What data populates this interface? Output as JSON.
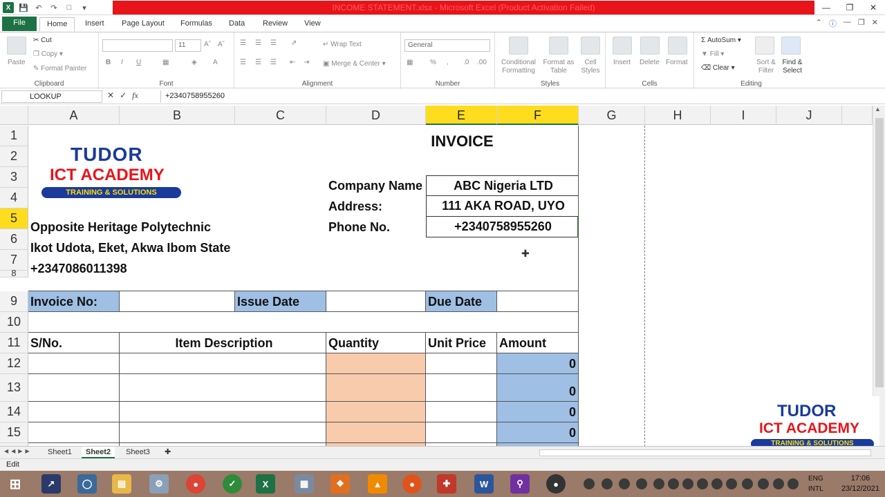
{
  "window": {
    "title": "INCOME STATEMENT.xlsx - Microsoft Excel (Product Activation Failed)",
    "help_icon": "help-icon"
  },
  "ribbon_tabs": [
    "File",
    "Home",
    "Insert",
    "Page Layout",
    "Formulas",
    "Data",
    "Review",
    "View"
  ],
  "ribbon": {
    "clipboard": {
      "paste": "Paste",
      "cut": "Cut",
      "copy": "Copy",
      "format_painter": "Format Painter",
      "label": "Clipboard"
    },
    "font": {
      "size": "11",
      "bold": "B",
      "italic": "I",
      "underline": "U",
      "label": "Font"
    },
    "alignment": {
      "wrap_text": "Wrap Text",
      "merge_center": "Merge & Center",
      "label": "Alignment"
    },
    "number": {
      "format": "General",
      "percent": "%",
      "comma": ",",
      "label": "Number"
    },
    "styles": {
      "conditional": "Conditional Formatting",
      "format_table": "Format as Table",
      "cell_styles": "Cell Styles",
      "label": "Styles"
    },
    "cells": {
      "insert": "Insert",
      "delete": "Delete",
      "format": "Format",
      "label": "Cells"
    },
    "editing": {
      "autosum": "AutoSum",
      "fill": "Fill",
      "clear": "Clear",
      "sort_filter": "Sort & Filter",
      "find_select": "Find & Select",
      "label": "Editing"
    }
  },
  "formula_bar": {
    "name_box": "LOOKUP",
    "cancel": "✕",
    "enter": "✓",
    "fx": "fx",
    "value": "+2340758955260"
  },
  "columns": [
    "A",
    "B",
    "C",
    "D",
    "E",
    "F",
    "G",
    "H",
    "I",
    "J"
  ],
  "rows": [
    "1",
    "2",
    "3",
    "4",
    "5",
    "6",
    "7",
    "8",
    "9",
    "10",
    "11",
    "12",
    "13",
    "14",
    "15"
  ],
  "invoice": {
    "title": "INVOICE",
    "logo": {
      "line1": "TUDOR",
      "line2": "ICT ACADEMY",
      "line3": "TRAINING & SOLUTIONS"
    },
    "company_label": "Company Name",
    "company_value": "ABC Nigeria LTD",
    "address_label": "Address:",
    "address_value": "111 AKA ROAD, UYO",
    "phone_label": "Phone No.",
    "phone_value": "+2340758955260",
    "sender_line1": "Opposite Heritage Polytechnic",
    "sender_line2": "Ikot Udota, Eket, Akwa Ibom State",
    "sender_phone": "+2347086011398",
    "invoice_no_label": "Invoice No:",
    "issue_date_label": "Issue Date",
    "due_date_label": "Due Date",
    "headers": [
      "S/No.",
      "Item Description",
      "Quantity",
      "Unit Price",
      "Amount"
    ],
    "amounts": [
      "0",
      "0",
      "0",
      "0"
    ]
  },
  "sheet_tabs": [
    "Sheet1",
    "Sheet2",
    "Sheet3"
  ],
  "active_sheet": "Sheet2",
  "status": {
    "mode": "Edit"
  },
  "watermark_logo": {
    "line1": "TUDOR",
    "line2": "ICT ACADEMY",
    "line3": "TRAINING & SOLUTIONS"
  },
  "taskbar": {
    "lang1": "ENG",
    "lang2": "INTL",
    "time": "17:06",
    "date": "23/12/2021"
  }
}
